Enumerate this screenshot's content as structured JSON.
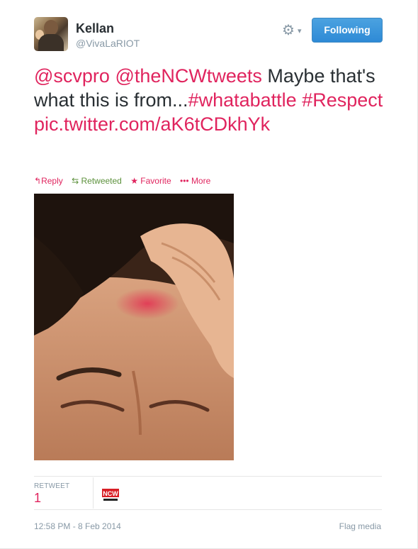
{
  "user": {
    "name": "Kellan",
    "handle": "@VivaLaRIOT",
    "avatar_icon": "profile-photo"
  },
  "header": {
    "gear_icon": "gear-icon",
    "follow_label": "Following"
  },
  "tweet": {
    "segments": [
      {
        "text": "@scvpro",
        "link": true
      },
      {
        "text": " ",
        "link": false
      },
      {
        "text": "@theNCWtweets",
        "link": true
      },
      {
        "text": " Maybe that's what this is from...",
        "link": false
      },
      {
        "text": "#whatabattle",
        "link": true
      },
      {
        "text": " ",
        "link": false
      },
      {
        "text": "#Respect",
        "link": true
      },
      {
        "text": " ",
        "link": false
      },
      {
        "text": "pic.twitter.com/aK6tCDkhYk",
        "link": true
      }
    ]
  },
  "actions": {
    "reply": "Reply",
    "retweeted": "Retweeted",
    "favorite": "Favorite",
    "more": "More"
  },
  "stats": {
    "retweet_label": "RETWEET",
    "retweet_count": "1",
    "retweeter_logo_text": "NCW"
  },
  "footer": {
    "timestamp": "12:58 PM - 8 Feb 2014",
    "flag_media": "Flag media"
  },
  "colors": {
    "link": "#e0245e",
    "muted": "#8899a6",
    "button_blue": "#2e8ad6",
    "retweet_green": "#5c913b"
  }
}
